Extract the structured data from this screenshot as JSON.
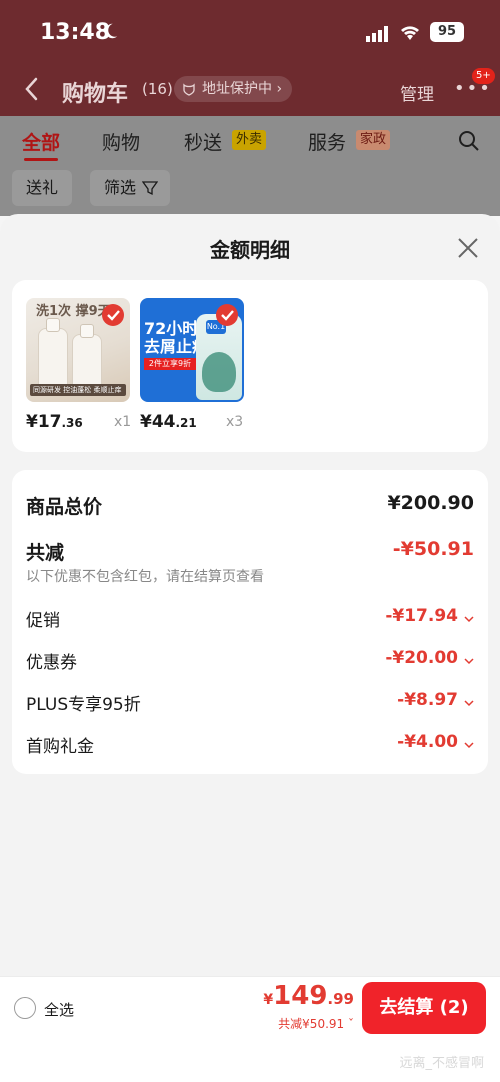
{
  "status_bar": {
    "time": "13:48",
    "battery": "95"
  },
  "nav": {
    "title": "购物车",
    "count": "(16)",
    "address_pill": "地址保护中",
    "manage": "管理",
    "more_badge": "5+"
  },
  "tabs": [
    {
      "label": "全部",
      "active": true
    },
    {
      "label": "购物"
    },
    {
      "label": "秒送",
      "badge": "外卖"
    },
    {
      "label": "服务",
      "badge": "家政"
    }
  ],
  "filters": {
    "gift": "送礼",
    "filter": "筛选"
  },
  "sheet": {
    "title": "金额明细",
    "products": [
      {
        "price_int": "¥17",
        "price_dec": ".36",
        "qty": "x1",
        "headline": "洗1次 撑9天",
        "tag": "同源研发 控油蓬松 柔顺止痒"
      },
      {
        "price_int": "¥44",
        "price_dec": ".21",
        "qty": "x3",
        "big_text_1": "72小时",
        "big_text_2": "去屑止痒",
        "strip": "2件立享9折",
        "badge": "No.1"
      }
    ],
    "summary": {
      "total_label": "商品总价",
      "total_value": "¥200.90",
      "discount_label": "共减",
      "discount_value": "-¥50.91",
      "note": "以下优惠不包含红包，请在结算页查看",
      "items": [
        {
          "label": "促销",
          "value": "-¥17.94"
        },
        {
          "label": "优惠券",
          "value": "-¥20.00"
        },
        {
          "label": "PLUS专享95折",
          "value": "-¥8.97"
        },
        {
          "label": "首购礼金",
          "value": "-¥4.00"
        }
      ]
    }
  },
  "bottom": {
    "select_all": "全选",
    "total_currency": "¥",
    "total_int": "149",
    "total_dec": ".99",
    "saved": "共减¥50.91",
    "checkout": "去结算 (2)"
  },
  "watermark": "远离_不感冒啊",
  "colors": {
    "accent_red": "#e23b32",
    "checkout_red": "#f0232a",
    "bg_dim_top": "#6e2b2f"
  }
}
